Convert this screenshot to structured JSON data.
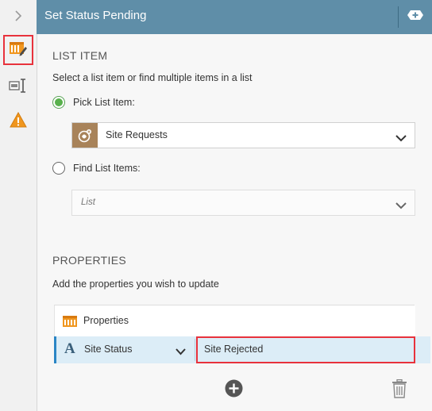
{
  "header": {
    "title": "Set Status Pending"
  },
  "rail": {
    "items": [
      {
        "name": "expand",
        "icon": "chevron-right-icon"
      },
      {
        "name": "general",
        "icon": "list-edit-icon",
        "highlighted": true
      },
      {
        "name": "configuration",
        "icon": "config-text-icon"
      },
      {
        "name": "warnings",
        "icon": "warning-icon"
      }
    ]
  },
  "list_item": {
    "section_title": "LIST ITEM",
    "description": "Select a list item or find multiple items in a list",
    "pick_option": {
      "label": "Pick List Item:",
      "selected": true
    },
    "pick_dropdown": {
      "value": "Site Requests",
      "icon": "site-requests-icon"
    },
    "find_option": {
      "label": "Find List Items:",
      "selected": false
    },
    "find_dropdown": {
      "placeholder": "List"
    }
  },
  "properties": {
    "section_title": "PROPERTIES",
    "description": "Add the properties you wish to update",
    "header_label": "Properties",
    "rows": [
      {
        "field": "Site Status",
        "value": "Site Rejected"
      }
    ]
  },
  "colors": {
    "header_bg": "#5f8ea8",
    "accent_green": "#58b04c",
    "highlight_red": "#e8323c",
    "row_selected_bg": "#dcedf7",
    "row_selected_border": "#2b86c5",
    "warning_orange": "#f0961e"
  }
}
